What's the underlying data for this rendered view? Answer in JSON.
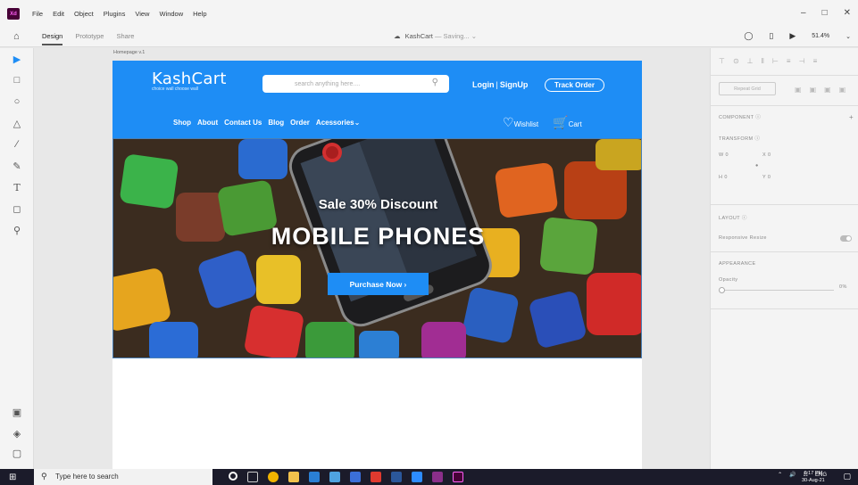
{
  "menubar": {
    "app_logo": "Xd",
    "items": [
      "File",
      "Edit",
      "Object",
      "Plugins",
      "View",
      "Window",
      "Help"
    ],
    "minimize": "–",
    "maximize": "□",
    "close": "✕"
  },
  "modebar": {
    "tabs": [
      "Design",
      "Prototype",
      "Share"
    ],
    "doc_name": "KashCart",
    "doc_status": "— Saving... ⌄",
    "zoom": "51.4%",
    "zoom_caret": "⌄"
  },
  "toolbar": {
    "icons": [
      "select-icon",
      "rectangle-icon",
      "ellipse-icon",
      "polygon-icon",
      "line-icon",
      "pen-icon",
      "text-icon",
      "artboard-icon",
      "zoom-icon"
    ],
    "bottom_icons": [
      "assets-icon",
      "layers-icon",
      "plugins-icon"
    ]
  },
  "artboard": {
    "label": "Homepage v.1"
  },
  "site": {
    "brand_name": "KashCart",
    "brand_tagline": "choice wall choose wall",
    "search_placeholder": "search anything here....",
    "login": "Login",
    "signup": "SignUp",
    "separator": "|",
    "track_order": "Track Order",
    "nav": [
      "Shop",
      "About",
      "Contact Us",
      "Blog",
      "Order",
      "Acessories⌄"
    ],
    "wishlist": "Wishlist",
    "cart": "Cart",
    "hero_sale": "Sale 30% Discount",
    "hero_title": "MOBILE PHONES",
    "hero_button": "Purchase Now  ›"
  },
  "panel": {
    "repeat_grid": "Repeat Grid",
    "component": "COMPONENT",
    "transform": "TRANSFORM",
    "w_label": "W",
    "w_value": "0",
    "x_label": "X",
    "x_value": "0",
    "h_label": "H",
    "h_value": "0",
    "y_label": "Y",
    "y_value": "0",
    "layout": "LAYOUT",
    "responsive_resize": "Responsive Resize",
    "appearance": "APPEARANCE",
    "opacity": "Opacity",
    "opacity_value": "0%",
    "add": "+"
  },
  "taskbar": {
    "search_text": "Type here to search",
    "time": "6:17 PM",
    "date": "30-Aug-21",
    "lang": "ENG",
    "apps": [
      "cortana",
      "task-view",
      "chrome",
      "file-explorer",
      "vscode",
      "photos",
      "sourcetree",
      "acrobat",
      "word",
      "zoom",
      "winrar",
      "xd"
    ]
  },
  "colors": {
    "site_blue": "#1e8df5",
    "xd_purple": "#470137",
    "taskbar": "#1b1b2a"
  }
}
